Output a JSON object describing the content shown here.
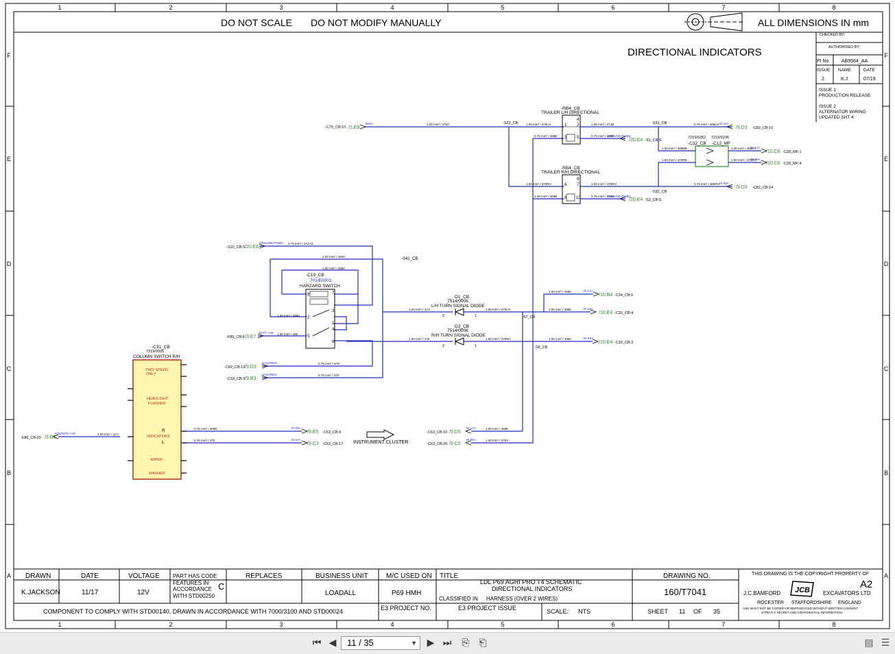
{
  "header": {
    "left_note": "DO NOT SCALE",
    "center_note": "DO NOT MODIFY MANUALLY",
    "right_note": "ALL DIMENSIONS IN mm"
  },
  "grid": {
    "columns": [
      "1",
      "2",
      "3",
      "4",
      "5",
      "6",
      "7",
      "8"
    ],
    "rows": [
      "F",
      "E",
      "D",
      "C",
      "B",
      "A"
    ]
  },
  "sheet_title": "DIRECTIONAL INDICATORS",
  "revision_block": {
    "checked_by": "CHECKED BY:",
    "authorised_by": "AUTHORISED BY:",
    "pi_no_label": "PI No",
    "pi_no_value": "AB9564_AA",
    "issue_label": "ISSUE",
    "name_label": "NAME",
    "date_label": "DATE",
    "issue_value": "2",
    "name_value": "K.J",
    "date_value": "07/19",
    "notes": [
      "ISSUE 1",
      "PRODUCTION RELEASE",
      "ISSUE 2",
      "ALTERNATOR WIRING",
      "UPDATED SHT 4"
    ]
  },
  "title_block": {
    "drawn_label": "DRAWN",
    "drawn_value": "K.JACKSON",
    "date_label": "DATE",
    "date_value": "11/17",
    "voltage_label": "VOLTAGE",
    "voltage_value": "12V",
    "code_lines": [
      "PART HAS CODE",
      "FEATURES IN",
      "ACCORDANCE",
      "WITH STD00250"
    ],
    "code_value": "C",
    "replaces_label": "REPLACES",
    "business_unit_label": "BUSINESS UNIT",
    "business_unit_value": "LOADALL",
    "mc_label": "M/C USED ON",
    "mc_value": "P69 HMH",
    "title_label": "TITLE",
    "title_line1": "LDL P69 AGRI PRO T4 SCHEMATIC",
    "title_line2": "DIRECTIONAL INDICATORS",
    "classified_label": "CLASSIFIED IN",
    "classified_value": "HARNESS (OVER 2 WIRES)",
    "drawing_no_label": "DRAWING NO.",
    "drawing_no_value": "160/T7041",
    "size": "A2",
    "copyright_line": "THIS DRAWING IS THE COPYRIGHT PROPERTY OF",
    "company_left": "J.C.BAMFORD",
    "company_right": "EXCAVATORS LTD",
    "logo_text": "JCB",
    "address": [
      "ROCESTER",
      "STAFFORDSHIRE",
      "ENGLAND"
    ],
    "legal_1": "AND MUST NOT BE COPIED OR REPRODUCED WITHOUT WRITTEN CONSENT.",
    "legal_2": "STRICTLY SECRET AND CONFIDENTIAL INFORMATION",
    "comply_note": "COMPONENT TO COMPLY WITH STD00140, DRAWN IN ACCORDANCE WITH 7000/3100 AND STD00024",
    "e3_project_no": "E3 PROJECT NO.",
    "e3_project_issue": "E3 PROJECT ISSUE",
    "scale_label": "SCALE:",
    "scale_value": "NTS",
    "sheet_label": "SHEET",
    "sheet_value": "11",
    "of_label": "OF",
    "of_value": "35"
  },
  "components": {
    "rb4_lh": {
      "ref": "-RB4_CB",
      "name": "TRAILER L/H DIRECTIONAL",
      "pins": [
        "1",
        "4",
        "2",
        "3",
        "5"
      ]
    },
    "rb4_rh": {
      "ref": "-RB4_CB",
      "name": "TRAILER R/H DIRECTIONAL",
      "pins": [
        "6",
        "9",
        "7",
        "8",
        "10"
      ]
    },
    "c19": {
      "ref": "-C19_CB",
      "part": "701/E0002",
      "name": "HARZARD SWITCH",
      "pins": [
        "8",
        "7",
        "2",
        "3",
        "1",
        "5",
        "4",
        "6"
      ]
    },
    "d1": {
      "ref": "-D1_CB",
      "part": "7514/0006",
      "name": "L/H TURN SIGNAL DIODE",
      "pins": [
        "2",
        "1"
      ]
    },
    "d2": {
      "ref": "-D2_CB",
      "part": "7514/0006",
      "name": "R/H TURN SIGNAL DIODE",
      "pins": [
        "2",
        "1"
      ]
    },
    "c31": {
      "ref": "-C31_CB",
      "part": "7219/0005",
      "name": "COLUMN SWITCH R/H",
      "functions": [
        "TWO SPEED",
        "ONLY",
        "HEADLIGHT",
        "FLASHER",
        "INDICATORS",
        "WIPER",
        "WASHER"
      ],
      "r_label": "R",
      "l_label": "L"
    },
    "c32_parts": [
      "7219/0282",
      "7219/0236"
    ],
    "c32_refs": [
      "-C32_CB",
      "-C12_MF"
    ],
    "instrument_cluster": "INSTRUMENT CLUSTER"
  },
  "connectors": {
    "c70": "-C70_CB:10",
    "c70_ref": "/5.E8",
    "c70_wire": "BDM",
    "s22": "-S22_CB",
    "s33": "-S33_CB",
    "s32": "-S32_CB",
    "s41": "-S41_CB",
    "s7": "-S7_CB",
    "s8": "-S8_CB",
    "c82_16": "-C82_CB:16",
    "c82_16_ref": "/9.D3",
    "c82_14": "-C82_CB:14",
    "c82_14_ref": "/9.D3",
    "s3_a": "-S3_CB:S",
    "s3_a_ref": "/20.E4",
    "s3_b": "-S3_CB:S",
    "s3_b_ref": "/20.E4",
    "ground_panel": "GROUND PANEL",
    "c28_1": "-C28_MF:1",
    "c28_1_ref": "/10.C6",
    "c28_4": "-C28_MF:4",
    "c28_4_ref": "/10.C6",
    "s10": "-S10_CB:S",
    "s10_ref": "/20.E6",
    "f89": "-F89_CB:8",
    "f89_ref": "/3.E7",
    "batt": "BATT +VE",
    "c82_13": "-C82_CB:13",
    "c82_13_ref": "/9.D3",
    "hazards": "HAZARDS",
    "c33_3": "-C33_CB:3",
    "c33_3_ref": "/9.B3",
    "c34_5": "-C34_CB:5",
    "c34_5_ref": "/10.B4",
    "c32_4": "-C32_CB:4",
    "c32_4_ref": "/10.E4",
    "c32_3": "-C32_CB:3",
    "c32_3_ref": "/10.E4",
    "f86": "-F86_CB:20",
    "f86_ref": "/3.E5",
    "ignition": "IGNITION +VE",
    "c63_4": "-C63_CB:4",
    "c63_4_ref": "/9.E5",
    "c63_17": "-C63_CB:17",
    "c63_17_ref": "/9.C3",
    "c63_10": "-C63_CB:10",
    "c63_10_ref": "/9.D5",
    "c63_20": "-C63_CB:20",
    "c63_20_ref": "/9.C5",
    "dir_lh": "DI L/H",
    "dir_rh": "DI R/H"
  },
  "viewer": {
    "page_indicator": "11 / 35"
  }
}
